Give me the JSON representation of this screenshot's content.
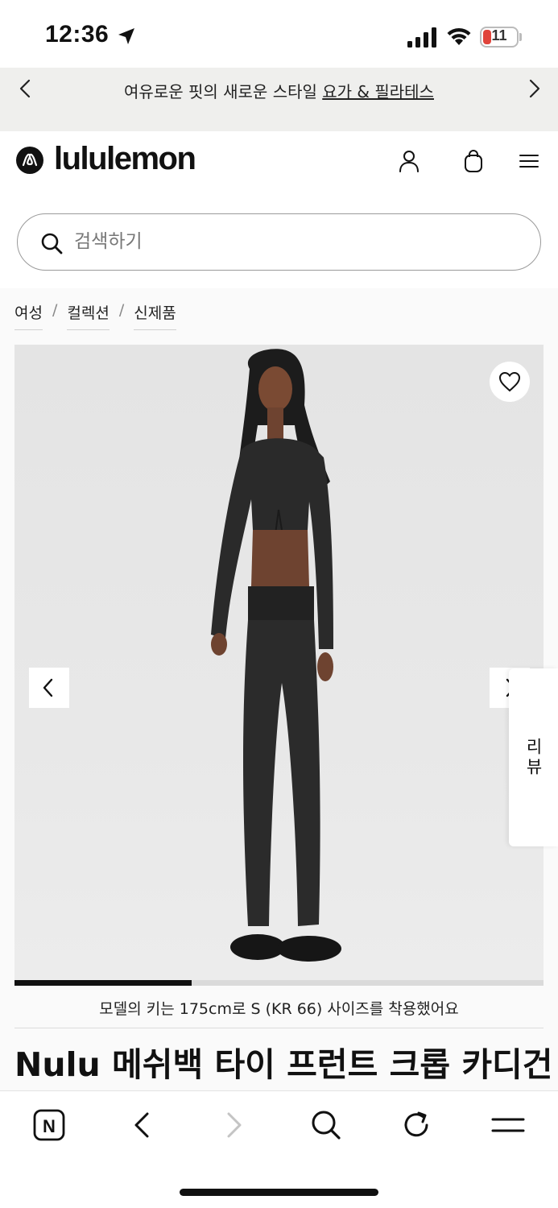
{
  "status_bar": {
    "time": "12:36",
    "battery_level": "11"
  },
  "promo_banner": {
    "text": "여유로운 핏의 새로운 스타일 ",
    "link": "요가 & 필라테스"
  },
  "header": {
    "brand": "lululemon",
    "search_placeholder": "검색하기"
  },
  "breadcrumb": {
    "items": [
      "여성",
      "컬렉션",
      "신제품"
    ],
    "separator": "/"
  },
  "gallery": {
    "progress_fraction": 0.335
  },
  "product": {
    "model_info": "모델의 키는 175cm로 S (KR 66) 사이즈를 착용했어요",
    "title": "Nulu 메쉬백 타이 프런트 크롭 카디건"
  },
  "reviews_tab": {
    "label": "리뷰"
  },
  "browser_toolbar": {
    "home_badge": "N"
  },
  "colors": {
    "banner_bg": "#efefed",
    "image_bg": "#e6e6e6",
    "text_primary": "#111111",
    "battery_low": "#e0443b"
  }
}
